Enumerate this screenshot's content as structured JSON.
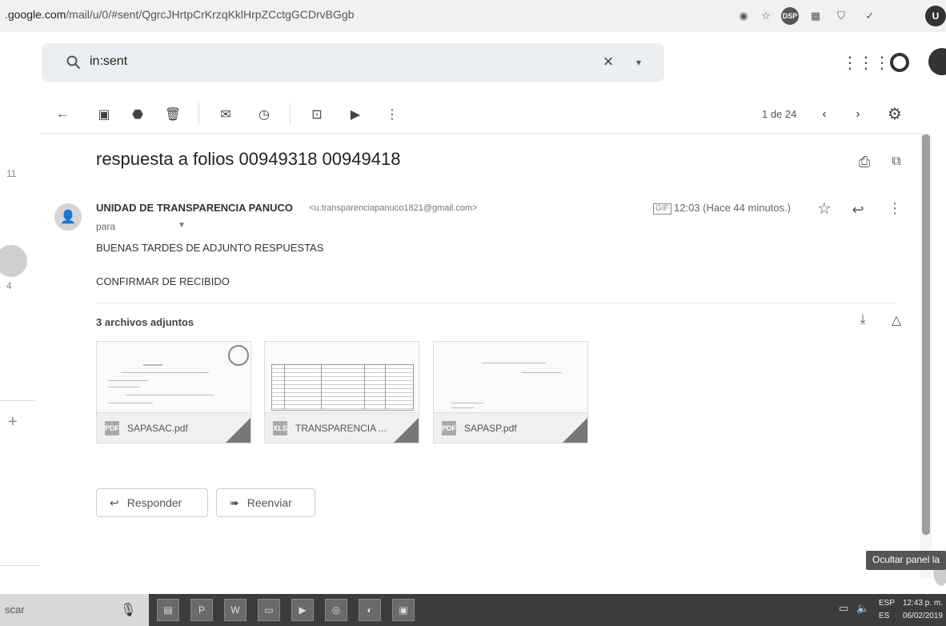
{
  "browser": {
    "url_host": "google.com",
    "url_path": "/mail/u/0/#sent/QgrcJHrtpCrKrzqKklHrpZCctgGCDrvBGgb",
    "url_prefix": "."
  },
  "search": {
    "query": "in:sent",
    "clear": "×",
    "options_caret": "▾"
  },
  "header": {
    "user_initial": "U"
  },
  "toolbar": {
    "pager": "1 de 24",
    "prev": "‹",
    "next": "›"
  },
  "rail": {
    "count_top": "11",
    "count_bottom": "4",
    "plus": "+"
  },
  "email": {
    "subject": "respuesta a folios 00949318 00949418",
    "sender_name": "UNIDAD DE TRANSPARENCIA PANUCO",
    "sender_email": "<u.transparenciapanuco1821@gmail.com>",
    "to_label": "para",
    "time": "12:03 (Hace 44 minutos.)",
    "body_lines": [
      "BUENAS TARDES DE ADJUNTO RESPUESTAS",
      "CONFIRMAR DE RECIBIDO"
    ]
  },
  "attachments": {
    "count_label": "3 archivos adjuntos",
    "files": [
      {
        "name": "SAPASAC.pdf"
      },
      {
        "name": "TRANSPARENCIA ..."
      },
      {
        "name": "SAPASP.pdf"
      }
    ]
  },
  "actions": {
    "reply": "Responder",
    "forward": "Reenviar"
  },
  "tooltip": "Ocultar panel la",
  "taskbar": {
    "search_text": "scar",
    "lang": "ESP",
    "lang_sub": "ES",
    "time": "12:43 p. m.",
    "date": "06/02/2019"
  },
  "icons": {
    "search": "search-icon",
    "back": "back-arrow-icon",
    "archive": "archive-icon",
    "spam": "report-spam-icon",
    "delete": "trash-icon",
    "mark_unread": "mark-unread-icon",
    "snooze": "snooze-icon",
    "move": "move-to-icon",
    "label": "label-icon",
    "settings": "gear-icon",
    "print": "print-icon",
    "new_window": "open-in-new-icon",
    "star": "star-icon",
    "reply": "reply-icon",
    "download": "download-icon",
    "drive": "drive-icon"
  },
  "colors": {
    "background": "#ffffff",
    "searchbox": "#eceff1",
    "taskbar": "#3c3c3c",
    "tooltip": "#555555"
  }
}
